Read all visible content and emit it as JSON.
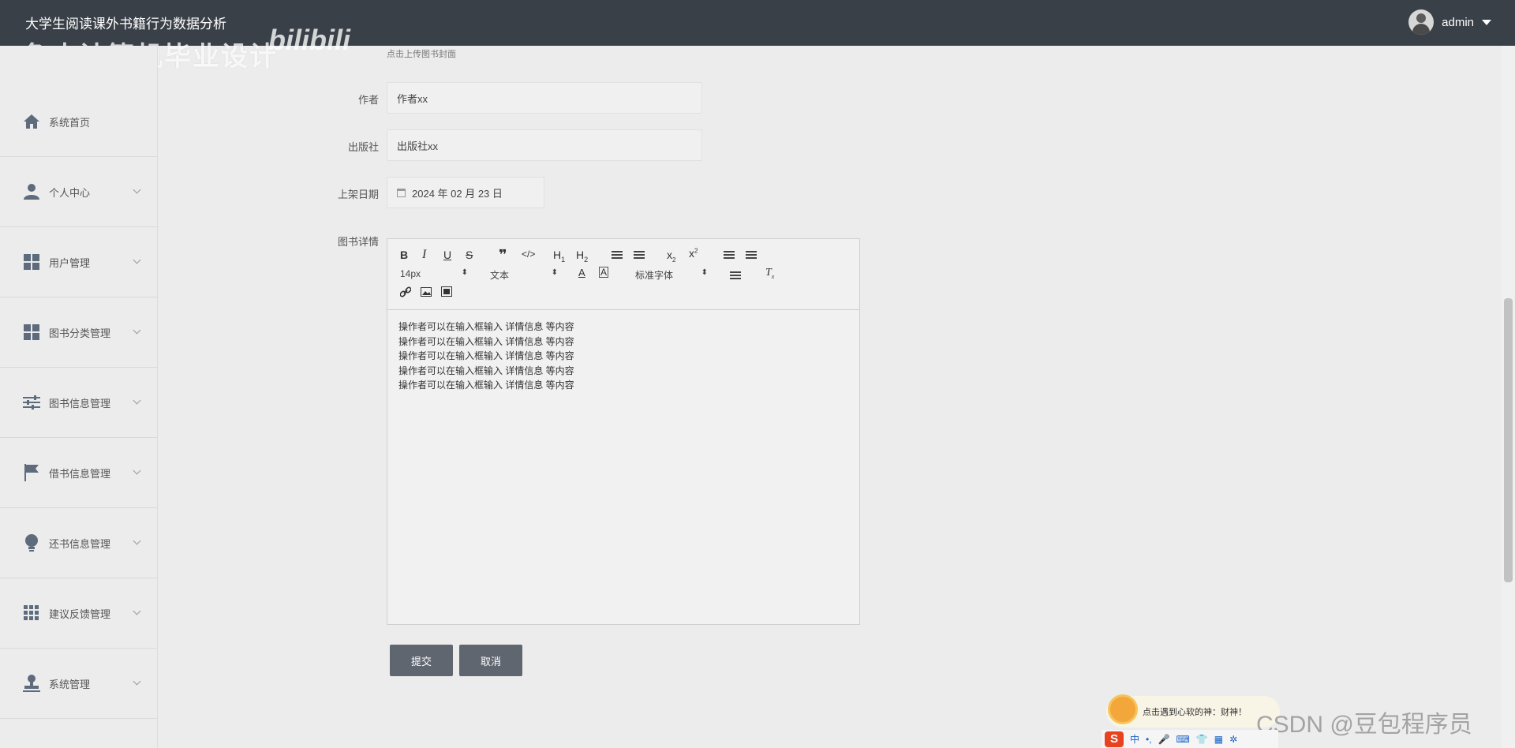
{
  "header": {
    "title": "大学生阅读课外书籍行为数据分析",
    "username": "admin"
  },
  "watermark": {
    "text": "鱼皮计算机毕业设计",
    "logo": "bilibili"
  },
  "sidebar": {
    "items": [
      {
        "label": "系统首页",
        "icon": "home-icon"
      },
      {
        "label": "个人中心",
        "icon": "user-icon"
      },
      {
        "label": "用户管理",
        "icon": "grid-icon"
      },
      {
        "label": "图书分类管理",
        "icon": "grid-icon"
      },
      {
        "label": "图书信息管理",
        "icon": "sliders-icon"
      },
      {
        "label": "借书信息管理",
        "icon": "flag-icon"
      },
      {
        "label": "还书信息管理",
        "icon": "bulb-icon"
      },
      {
        "label": "建议反馈管理",
        "icon": "apps-icon"
      },
      {
        "label": "系统管理",
        "icon": "stamp-icon"
      }
    ]
  },
  "form": {
    "cover_hint": "点击上传图书封面",
    "author": {
      "label": "作者",
      "value": "作者xx"
    },
    "publisher": {
      "label": "出版社",
      "value": "出版社xx"
    },
    "date": {
      "label": "上架日期",
      "value": "2024 年 02 月 23 日"
    },
    "detail": {
      "label": "图书详情",
      "toolbar": {
        "font_size": "14px",
        "paragraph": "文本",
        "font_family": "标准字体"
      },
      "lines": [
        "操作者可以在输入框输入 详情信息 等内容",
        "操作者可以在输入框输入 详情信息 等内容",
        "操作者可以在输入框输入 详情信息 等内容",
        "操作者可以在输入框输入 详情信息 等内容",
        "操作者可以在输入框输入 详情信息 等内容"
      ]
    },
    "submit_label": "提交",
    "cancel_label": "取消"
  },
  "overlay": {
    "ime_tip": "点击遇到心软的神：财神！",
    "ime_mode": "中",
    "csdn": "CSDN @豆包程序员"
  }
}
